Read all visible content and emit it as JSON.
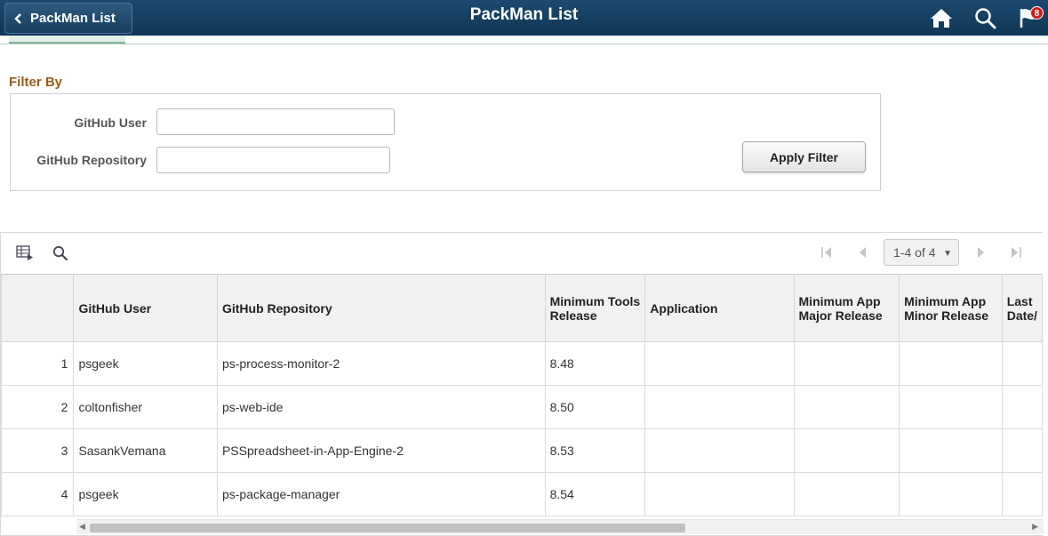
{
  "header": {
    "back_label": "PackMan List",
    "title": "PackMan List",
    "notification_count": "8"
  },
  "filter": {
    "title": "Filter By",
    "github_user_label": "GitHub User",
    "github_user_value": "",
    "github_repo_label": "GitHub Repository",
    "github_repo_value": "",
    "apply_label": "Apply Filter"
  },
  "grid": {
    "pager_text": "1-4 of 4",
    "columns": [
      "",
      "GitHub User",
      "GitHub Repository",
      "Minimum Tools Release",
      "Application",
      "Minimum App Major Release",
      "Minimum App Minor Release",
      "Last Date/"
    ],
    "rows": [
      {
        "num": "1",
        "user": "psgeek",
        "repo": "ps-process-monitor-2",
        "tools": "8.48",
        "app": "",
        "major": "",
        "minor": "",
        "last": ""
      },
      {
        "num": "2",
        "user": "coltonfisher",
        "repo": "ps-web-ide",
        "tools": "8.50",
        "app": "",
        "major": "",
        "minor": "",
        "last": ""
      },
      {
        "num": "3",
        "user": "SasankVemana",
        "repo": "PSSpreadsheet-in-App-Engine-2",
        "tools": "8.53",
        "app": "",
        "major": "",
        "minor": "",
        "last": ""
      },
      {
        "num": "4",
        "user": "psgeek",
        "repo": "ps-package-manager",
        "tools": "8.54",
        "app": "",
        "major": "",
        "minor": "",
        "last": ""
      }
    ]
  },
  "icons": {
    "back": "chevron-left-icon",
    "home": "home-icon",
    "search": "search-icon",
    "notifications": "flag-icon",
    "grid_personalize": "grid-personalize-icon",
    "grid_find": "search-icon",
    "first": "first-page-icon",
    "prev": "previous-page-icon",
    "next": "next-page-icon",
    "last": "last-page-icon"
  }
}
